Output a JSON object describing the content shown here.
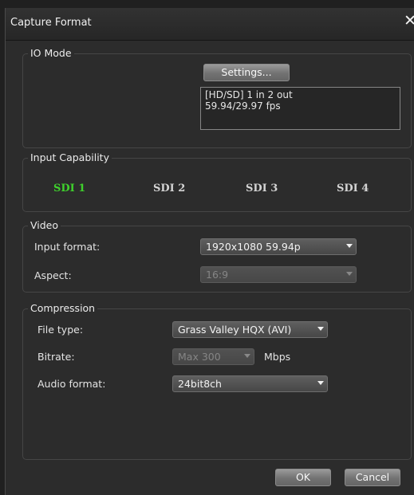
{
  "window": {
    "title": "Capture Format",
    "close_symbol": "✕"
  },
  "io_mode": {
    "legend": "IO Mode",
    "settings_label": "Settings...",
    "info_lines": [
      "[HD/SD] 1 in 2 out",
      "59.94/29.97 fps"
    ]
  },
  "input_capability": {
    "legend": "Input Capability",
    "channels": [
      "SDI 1",
      "SDI 2",
      "SDI 3",
      "SDI 4"
    ],
    "active_channel": "SDI 1",
    "active_color": "#3fd12c"
  },
  "video": {
    "legend": "Video",
    "input_format_label": "Input format:",
    "input_format_value": "1920x1080 59.94p",
    "aspect_label": "Aspect:",
    "aspect_value": "16:9"
  },
  "compression": {
    "legend": "Compression",
    "file_type_label": "File type:",
    "file_type_value": "Grass Valley HQX (AVI)",
    "bitrate_label": "Bitrate:",
    "bitrate_value": "Max 300",
    "bitrate_unit": "Mbps",
    "audio_format_label": "Audio format:",
    "audio_format_value": "24bit8ch"
  },
  "footer": {
    "ok_label": "OK",
    "cancel_label": "Cancel"
  }
}
